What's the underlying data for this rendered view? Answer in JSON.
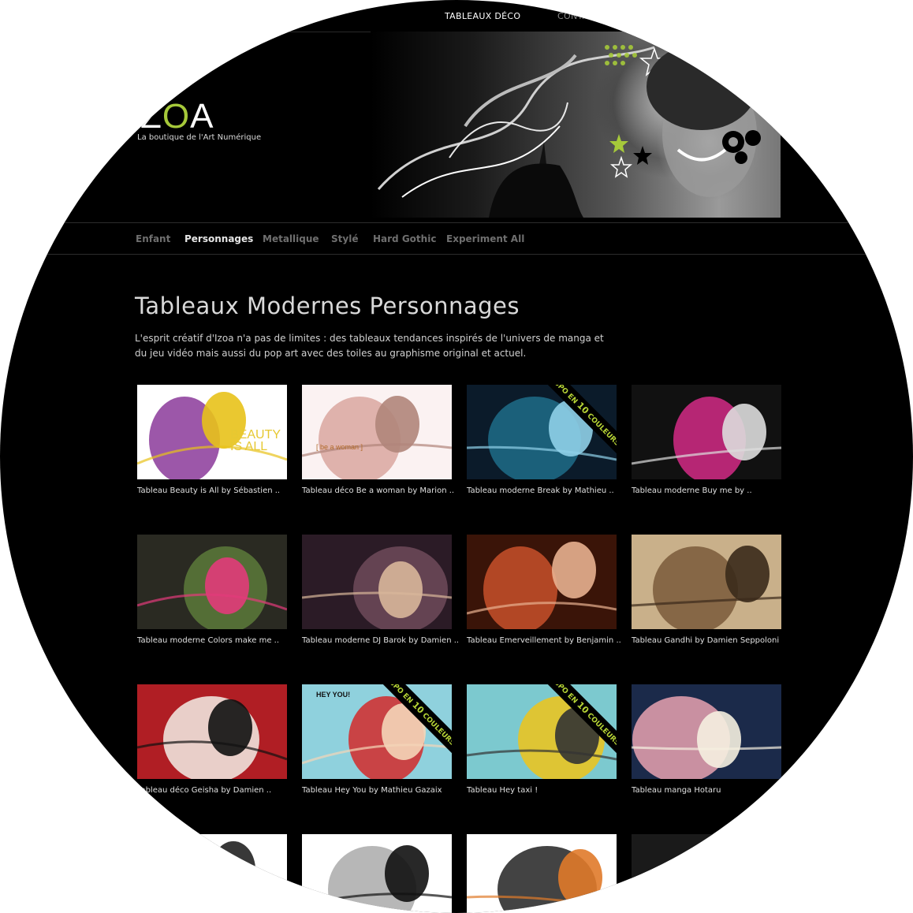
{
  "top_nav": {
    "items": [
      "TABLEAUX DÉCO",
      "CONTA"
    ]
  },
  "logo": {
    "mark_visible": "ZOA",
    "tagline": "La boutique de l'Art Numérique"
  },
  "category_nav": {
    "items": [
      "Enfant",
      "Personnages",
      "Metallique",
      "Stylé",
      "Hard Gothic",
      "Experiment All"
    ],
    "active": "Personnages"
  },
  "page": {
    "title": "Tableaux Modernes Personnages",
    "intro": "L'esprit créatif d'Izoa n'a pas de limites : des tableaux tendances inspirés de l'univers de manga et du jeu vidéo mais aussi du pop art avec des toiles au graphisme original et actuel."
  },
  "ribbon": {
    "prefix": "DISPO EN",
    "number": "10",
    "suffix": "COULEURS"
  },
  "products": [
    {
      "caption": "Tableau Beauty is All by Sébastien ..",
      "thumb_text": "BEAUTY IS ALL",
      "ribbon": false,
      "palette": [
        "#ffffff",
        "#8b3a9a",
        "#e8c21a"
      ]
    },
    {
      "caption": "Tableau déco Be a woman by Marion ..",
      "thumb_text": "[ be a woman ]",
      "ribbon": false,
      "palette": [
        "#fbf2f2",
        "#d9a7a0",
        "#b0857a"
      ]
    },
    {
      "caption": "Tableau moderne Break by Mathieu ..",
      "thumb_text": "",
      "ribbon": true,
      "palette": [
        "#0b1b2a",
        "#1f6c88",
        "#8fd0e8"
      ]
    },
    {
      "caption": "Tableau moderne Buy me by ..",
      "thumb_text": "",
      "ribbon": false,
      "palette": [
        "#111111",
        "#d42a86",
        "#dddddd"
      ]
    },
    {
      "caption": "Tableau moderne Colors make me ..",
      "thumb_text": "",
      "ribbon": false,
      "palette": [
        "#2a2a22",
        "#5c7a3a",
        "#e23b7a"
      ]
    },
    {
      "caption": "Tableau moderne DJ Barok by Damien ..",
      "thumb_text": "",
      "ribbon": false,
      "palette": [
        "#2b1b26",
        "#6e4a5a",
        "#d8b79a"
      ]
    },
    {
      "caption": "Tableau Emerveillement by Benjamin ..",
      "thumb_text": "",
      "ribbon": false,
      "palette": [
        "#3a1408",
        "#c8502a",
        "#e8b090"
      ]
    },
    {
      "caption": "Tableau Gandhi by Damien Seppoloni",
      "thumb_text": "",
      "ribbon": false,
      "palette": [
        "#c9b08a",
        "#7a5a3a",
        "#3a2a1a"
      ]
    },
    {
      "caption": "Tableau déco Geisha by Damien ..",
      "thumb_text": "",
      "ribbon": false,
      "palette": [
        "#b01e24",
        "#f3efe6",
        "#111111"
      ]
    },
    {
      "caption": "Tableau Hey You by Mathieu Gazaix",
      "thumb_text": "HEY YOU!",
      "ribbon": true,
      "palette": [
        "#8fd1dd",
        "#d32a2a",
        "#f4d6b8"
      ]
    },
    {
      "caption": "Tableau Hey taxi !",
      "thumb_text": "",
      "ribbon": true,
      "palette": [
        "#7cc9cf",
        "#f0c419",
        "#333333"
      ]
    },
    {
      "caption": "Tableau manga Hotaru",
      "thumb_text": "",
      "ribbon": false,
      "palette": [
        "#1b2a4a",
        "#e8a2b0",
        "#f5efe0"
      ]
    },
    {
      "caption": "",
      "thumb_text": "",
      "ribbon": false,
      "palette": [
        "#ffffff",
        "#999999",
        "#222222"
      ]
    },
    {
      "caption": "",
      "thumb_text": "",
      "ribbon": false,
      "palette": [
        "#ffffff",
        "#aaaaaa",
        "#111111"
      ]
    },
    {
      "caption": "",
      "thumb_text": "",
      "ribbon": false,
      "palette": [
        "#ffffff",
        "#222222",
        "#e07a2a"
      ]
    },
    {
      "caption": "",
      "thumb_text": "",
      "ribbon": false,
      "palette": [
        "#1a1a1a",
        "#5a4a3a",
        "#9a7a5a"
      ]
    }
  ],
  "colors": {
    "background": "#000000",
    "accent": "#a6c93a",
    "nav_active": "#e6e6e6",
    "nav_inactive": "#6f6f6f"
  }
}
